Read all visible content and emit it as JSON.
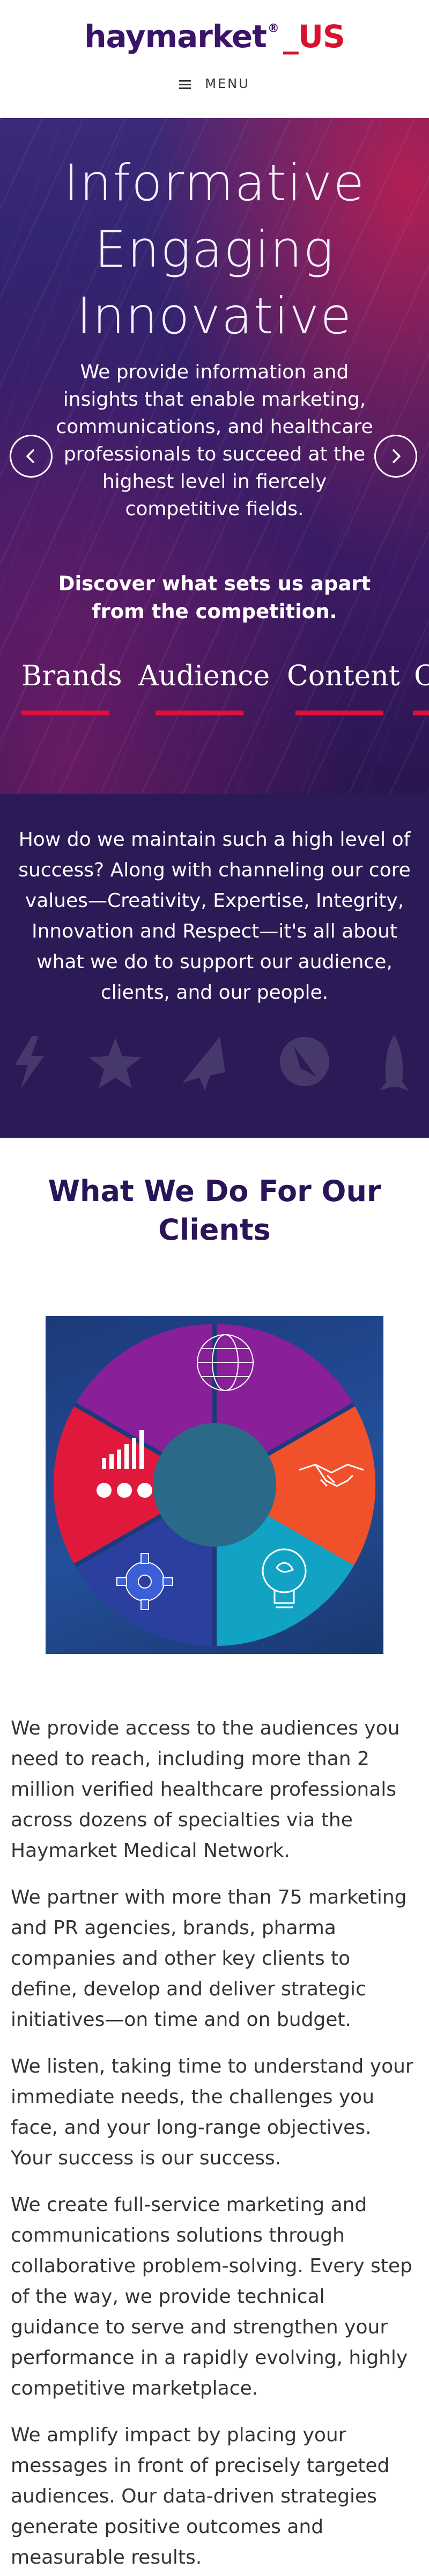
{
  "header": {
    "logo_brand": "haymarket",
    "logo_reg": "®",
    "logo_region": "_US",
    "menu_label": "MENU"
  },
  "hero": {
    "tagline": [
      "Informative",
      "Engaging",
      "Innovative"
    ],
    "description": "We provide information and insights that enable marketing, communications, and healthcare professionals to succeed at the highest level in fiercely competitive fields.",
    "cta": "Discover what sets us apart from the competition.",
    "tabs": [
      "Brands",
      "Audience",
      "Content",
      "C"
    ]
  },
  "values": {
    "text": "How do we maintain such a high level of success? Along with channeling our core values—Creativity, Expertise, Integrity, Innovation and Respect—it's all about what we do to support our audience, clients, and our people."
  },
  "what_we_do": {
    "title": "What We Do For Our Clients",
    "paragraphs": [
      "We provide access to the audiences you need to reach, including more than 2 million verified healthcare professionals across dozens of specialties via the Haymarket Medical Network.",
      "We partner with more than 75 marketing and PR agencies, brands, pharma companies and other key clients to define, develop and deliver strategic initiatives—on time and on budget.",
      "We listen, taking time to understand your immediate needs, the challenges you face, and your long-range objectives. Your success is our success.",
      "We create full-service marketing and communications solutions through collaborative problem-solving. Every step of the way, we provide technical guidance to serve and strengthen your performance in a rapidly evolving, highly competitive marketplace.",
      "We amplify impact by placing your messages in front of precisely targeted audiences. Our data-driven strategies generate positive outcomes and measurable results."
    ]
  },
  "colors": {
    "brand_purple": "#3a1468",
    "brand_red": "#d9112f",
    "hero_dark": "#2b1a56",
    "wheel_purple": "#8a1f9a",
    "wheel_orange": "#f0502a",
    "wheel_teal": "#12a3c4",
    "wheel_blue": "#2b3f9e",
    "wheel_red": "#e0193c"
  },
  "icons": [
    "menu-icon",
    "chevron-left-icon",
    "chevron-right-icon",
    "globe-icon",
    "handshake-icon",
    "lightbulb-icon",
    "gear-icon",
    "bar-chart-icon"
  ]
}
